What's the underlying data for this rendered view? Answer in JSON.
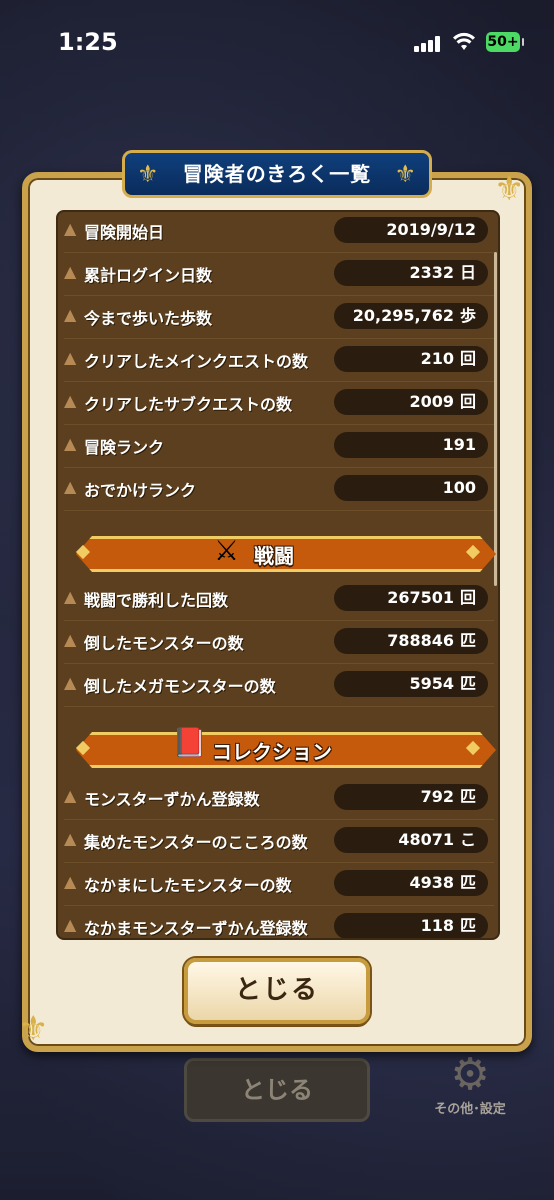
{
  "status_bar": {
    "time": "1:25",
    "battery": "50+"
  },
  "dialog": {
    "title": "冒険者のきろく一覧",
    "rows_top": [
      {
        "label": "冒険開始日",
        "value": "2019/9/12",
        "unit": ""
      },
      {
        "label": "累計ログイン日数",
        "value": "2332",
        "unit": "日"
      },
      {
        "label": "今まで歩いた歩数",
        "value": "20,295,762",
        "unit": "歩"
      },
      {
        "label": "クリアしたメインクエストの数",
        "value": "210",
        "unit": "回"
      },
      {
        "label": "クリアしたサブクエストの数",
        "value": "2009",
        "unit": "回"
      },
      {
        "label": "冒険ランク",
        "value": "191",
        "unit": ""
      },
      {
        "label": "おでかけランク",
        "value": "100",
        "unit": ""
      }
    ],
    "battle_section": {
      "title": "戦闘",
      "rows": [
        {
          "label": "戦闘で勝利した回数",
          "value": "267501",
          "unit": "回"
        },
        {
          "label": "倒したモンスターの数",
          "value": "788846",
          "unit": "匹"
        },
        {
          "label": "倒したメガモンスターの数",
          "value": "5954",
          "unit": "匹"
        }
      ]
    },
    "collection_section": {
      "title": "コレクション",
      "rows": [
        {
          "label": "モンスターずかん登録数",
          "value": "792",
          "unit": "匹"
        },
        {
          "label": "集めたモンスターのこころの数",
          "value": "48071",
          "unit": "こ"
        },
        {
          "label": "なかまにしたモンスターの数",
          "value": "4938",
          "unit": "匹"
        },
        {
          "label": "なかまモンスターずかん登録数",
          "value": "118",
          "unit": "匹"
        }
      ]
    },
    "close_label": "とじる"
  },
  "background": {
    "close_label": "とじる",
    "settings_label": "その他･設定"
  }
}
